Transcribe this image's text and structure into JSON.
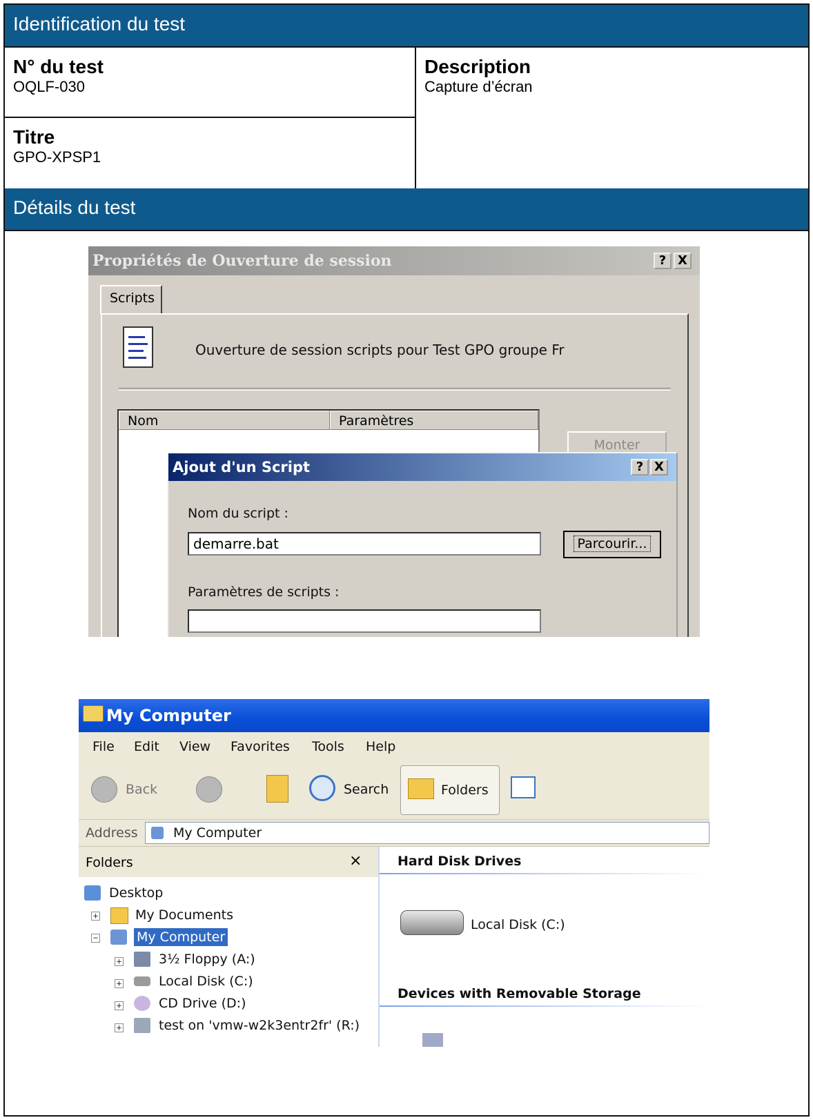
{
  "section_identification": "Identification du test",
  "num_label": "N° du test",
  "num_value": "OQLF-030",
  "titre_label": "Titre",
  "titre_value": "GPO-XPSP1",
  "desc_label": "Description",
  "desc_value": "Capture d’écran",
  "section_details": "Détails du test",
  "dialog1": {
    "title": "Propriétés de Ouverture de session",
    "help_btn": "?",
    "close_btn": "X",
    "tab": "Scripts",
    "header_text": "Ouverture de session scripts pour Test GPO groupe Fr",
    "col_nom": "Nom",
    "col_params": "Paramètres",
    "btn_monter": "Monter"
  },
  "dialog2": {
    "title": "Ajout d'un Script",
    "help_btn": "?",
    "close_btn": "X",
    "label_name": "Nom du script :",
    "name_value": "demarre.bat",
    "btn_browse": "Parcourir...",
    "label_params": "Paramètres de scripts :",
    "params_value": ""
  },
  "explorer": {
    "title": "My Computer",
    "menu": [
      "File",
      "Edit",
      "View",
      "Favorites",
      "Tools",
      "Help"
    ],
    "toolbar": {
      "back": "Back",
      "search": "Search",
      "folders": "Folders"
    },
    "address_label": "Address",
    "address_value": "My Computer",
    "folders_header": "Folders",
    "folders_close": "×",
    "tree": [
      "Desktop",
      "My Documents",
      "My Computer",
      "3½ Floppy (A:)",
      "Local Disk (C:)",
      "CD Drive (D:)",
      "test on 'vmw-w2k3entr2fr' (R:)"
    ],
    "section_hdd": "Hard Disk Drives",
    "disk_c": "Local Disk (C:)",
    "section_removable": "Devices with Removable Storage"
  },
  "colors": {
    "band": "#0f5a8c",
    "dlg_active": "#0a246a",
    "xp_title": "#0a4fd8",
    "selection": "#316ac5"
  }
}
